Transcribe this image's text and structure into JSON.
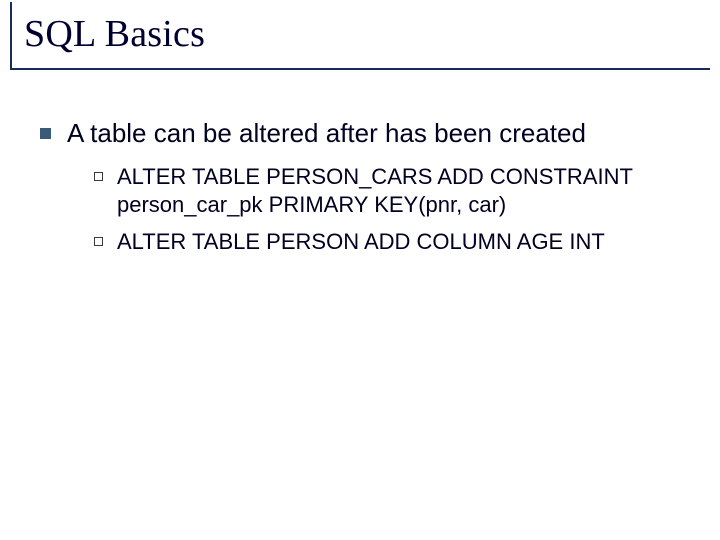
{
  "title": "SQL Basics",
  "bullets": {
    "main": "A table can be altered after has been created",
    "subs": [
      "ALTER TABLE PERSON_CARS ADD CONSTRAINT person_car_pk PRIMARY KEY(pnr, car)",
      "ALTER TABLE PERSON ADD COLUMN AGE INT"
    ]
  }
}
